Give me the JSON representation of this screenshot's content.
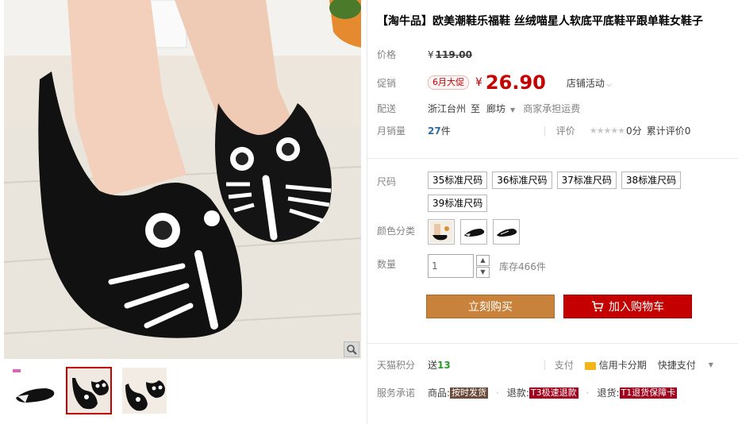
{
  "product": {
    "title": "【淘牛品】欧美潮鞋乐福鞋 丝绒喵星人软底平底鞋平跟单鞋女鞋子"
  },
  "price": {
    "label": "价格",
    "currency": "¥",
    "original": "119.00"
  },
  "promo": {
    "label": "促销",
    "tag": "6月大促",
    "currency": "¥",
    "price": "26.90",
    "store_activity": "店铺活动"
  },
  "shipping": {
    "label": "配送",
    "from": "浙江台州",
    "to_word": "至",
    "destination": "廊坊",
    "fee": "商家承担运费"
  },
  "sales": {
    "label": "月销量",
    "count": "27",
    "unit": "件",
    "rating_label": "评价",
    "stars": "★★★★★",
    "score": "0分",
    "total_reviews": "累计评价0"
  },
  "size": {
    "label": "尺码",
    "options": [
      "35标准尺码",
      "36标准尺码",
      "37标准尺码",
      "38标准尺码",
      "39标准尺码"
    ]
  },
  "color": {
    "label": "颜色分类"
  },
  "quantity": {
    "label": "数量",
    "value": "1",
    "stock": "库存466件"
  },
  "actions": {
    "buy_now": "立刻购买",
    "add_to_cart": "加入购物车"
  },
  "points": {
    "label": "天猫积分",
    "give": "送",
    "value": "13",
    "pay_label": "支付",
    "credit": "信用卡分期",
    "quick_pay": "快捷支付"
  },
  "service": {
    "label": "服务承诺",
    "goods_label": "商品:",
    "goods_tag": "按时发货",
    "refund_label": "退款:",
    "refund_tag": "T3极速退款",
    "return_label": "退货:",
    "return_tag": "T1退货保障卡"
  },
  "colors": {
    "accent": "#c40000",
    "buy": "#c8823c",
    "link": "#2e69a3"
  }
}
